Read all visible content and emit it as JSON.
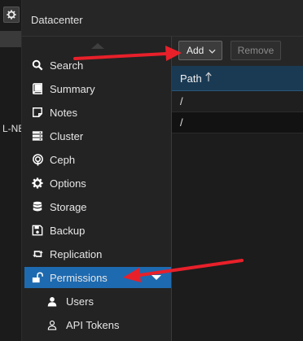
{
  "left_strip": {
    "cut_text": "L-NE"
  },
  "header": {
    "title": "Datacenter"
  },
  "nav": {
    "items": [
      {
        "label": "Search",
        "icon": "search-icon"
      },
      {
        "label": "Summary",
        "icon": "book-icon"
      },
      {
        "label": "Notes",
        "icon": "notes-icon"
      },
      {
        "label": "Cluster",
        "icon": "server-icon"
      },
      {
        "label": "Ceph",
        "icon": "ceph-icon"
      },
      {
        "label": "Options",
        "icon": "gear-icon"
      },
      {
        "label": "Storage",
        "icon": "database-icon"
      },
      {
        "label": "Backup",
        "icon": "floppy-icon"
      },
      {
        "label": "Replication",
        "icon": "retweet-icon"
      },
      {
        "label": "Permissions",
        "icon": "unlock-icon",
        "selected": true,
        "expanded": true
      },
      {
        "label": "Users",
        "icon": "user-icon",
        "child": true
      },
      {
        "label": "API Tokens",
        "icon": "user-outline-icon",
        "child": true
      }
    ]
  },
  "toolbar": {
    "add_label": "Add",
    "remove_label": "Remove"
  },
  "grid": {
    "columns": [
      {
        "label": "Path",
        "sort": "ascending"
      }
    ],
    "rows": [
      {
        "path": "/"
      },
      {
        "path": "/"
      }
    ]
  },
  "colors": {
    "selection": "#1e6ab0",
    "annotation_arrow": "#e8202a",
    "grid_header": "#1a3a54"
  }
}
